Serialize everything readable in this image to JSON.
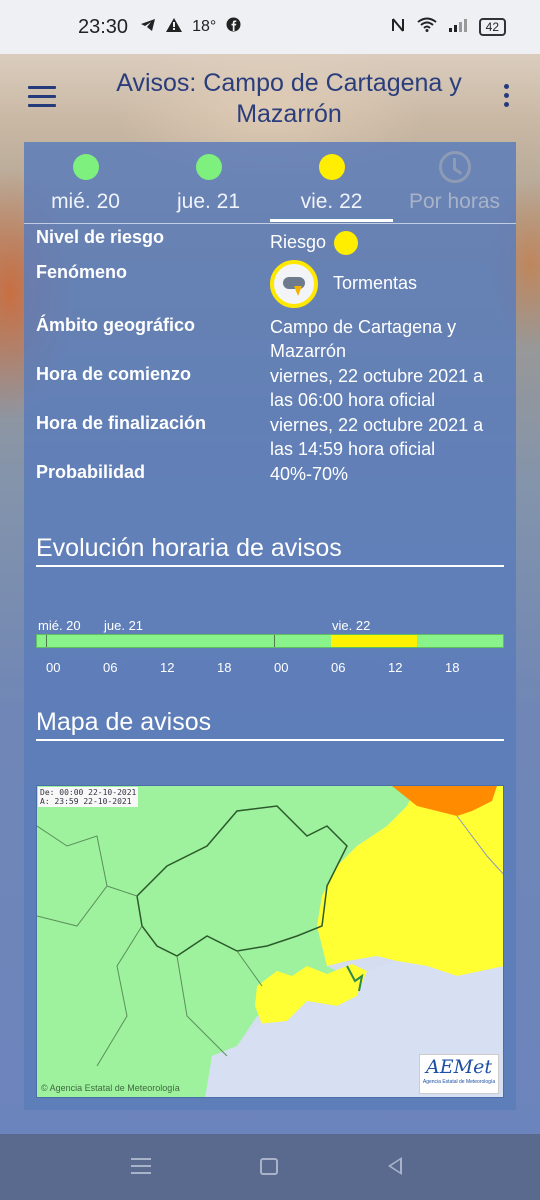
{
  "status_bar": {
    "time": "23:30",
    "notification_icons": [
      "telegram-icon",
      "warning-icon",
      "facebook-icon"
    ],
    "temperature": "18°",
    "battery": "42",
    "right_icons": [
      "nfc-icon",
      "wifi-icon",
      "signal-icon",
      "battery-icon"
    ]
  },
  "header": {
    "title": "Avisos: Campo de Cartagena y Mazarrón"
  },
  "tabs": [
    {
      "label": "mié. 20",
      "indicator_color": "#7df07d",
      "selected": false
    },
    {
      "label": "jue. 21",
      "indicator_color": "#7df07d",
      "selected": false
    },
    {
      "label": "vie. 22",
      "indicator_color": "#ffee00",
      "selected": true
    },
    {
      "label": "Por horas",
      "icon": "clock-icon",
      "selected": false
    }
  ],
  "warning": {
    "risk_label": "Nivel de riesgo",
    "risk_value": "Riesgo",
    "risk_color": "#ffee00",
    "phenomenon_label": "Fenómeno",
    "phenomenon_value": "Tormentas",
    "phenomenon_icon": "thunderstorm-icon",
    "scope_label": "Ámbito geográfico",
    "scope_value": "Campo de Cartagena y Mazarrón",
    "start_label": "Hora de comienzo",
    "start_value": "viernes, 22 octubre 2021 a las 06:00 hora oficial",
    "end_label": "Hora de finalización",
    "end_value": "viernes, 22 octubre 2021 a las 14:59 hora oficial",
    "probability_label": "Probabilidad",
    "probability_value": "40%-70%"
  },
  "timeline": {
    "title": "Evolución horaria de avisos",
    "days": [
      "mié. 20",
      "jue. 21",
      "vie. 22"
    ],
    "hours": [
      "00",
      "06",
      "12",
      "18",
      "00",
      "06",
      "12",
      "18"
    ],
    "colors": {
      "green": "#8af28a",
      "yellow": "#fff200"
    }
  },
  "map": {
    "title": "Mapa de avisos",
    "date_from": "De: 00:00 22-10-2021",
    "date_to": "A: 23:59 22-10-2021",
    "agency": "Agencia Estatal de Meteorología",
    "logo": "AEMet",
    "logo_sub": "Agencia Estatal de Meteorología",
    "colors": {
      "green": "#9ef29e",
      "yellow": "#ffff33",
      "orange": "#ff8c00",
      "sea": "#d6e0f2"
    }
  },
  "nav_bar": [
    "recent-apps-icon",
    "home-icon",
    "back-icon"
  ]
}
